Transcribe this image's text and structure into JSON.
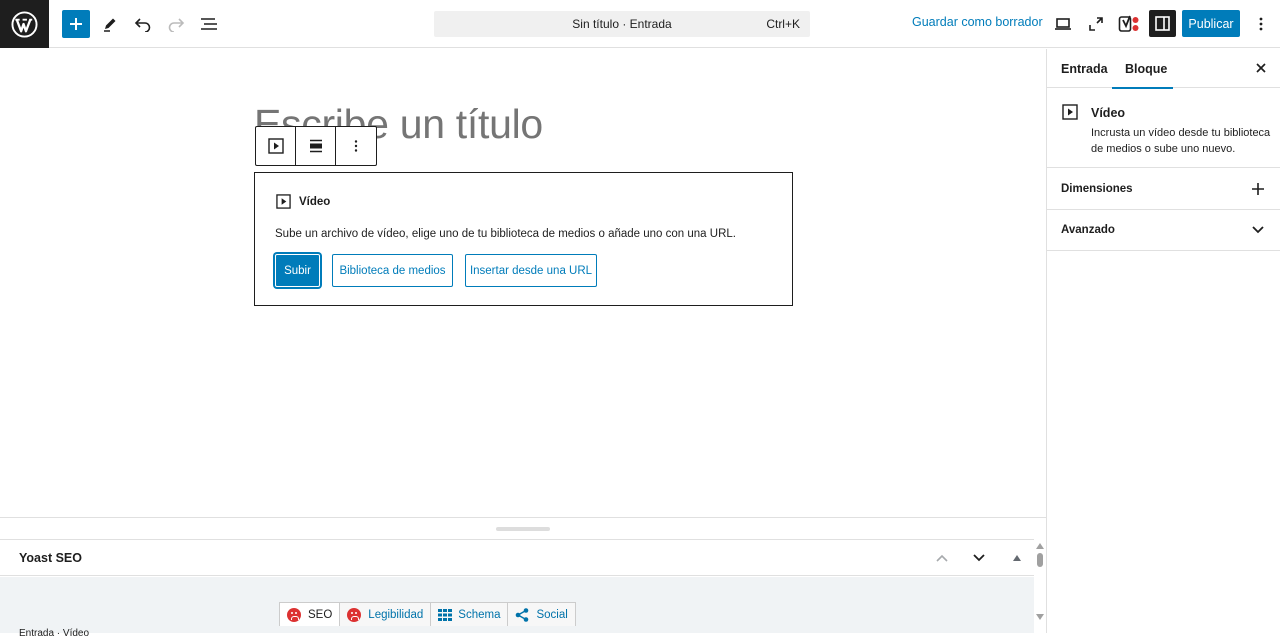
{
  "header": {
    "command_title": "Sin título · Entrada",
    "command_shortcut": "Ctrl+K",
    "save_draft": "Guardar como borrador",
    "publish": "Publicar"
  },
  "editor": {
    "title_placeholder": "Escribe un título",
    "video_block": {
      "label": "Vídeo",
      "description": "Sube un archivo de vídeo, elige uno de tu biblioteca de medios o añade uno con una URL.",
      "upload": "Subir",
      "media_library": "Biblioteca de medios",
      "insert_url": "Insertar desde una URL"
    }
  },
  "sidebar": {
    "tab_post": "Entrada",
    "tab_block": "Bloque",
    "block_title": "Vídeo",
    "block_description": "Incrusta un vídeo desde tu biblioteca de medios o sube uno nuevo.",
    "panels": [
      "Dimensiones",
      "Avanzado"
    ]
  },
  "metabox": {
    "title": "Yoast SEO",
    "tabs": [
      "SEO",
      "Legibilidad",
      "Schema",
      "Social"
    ]
  },
  "status_bar": "Entrada · Vídeo",
  "colors": {
    "accent": "#007cba",
    "dark": "#1e1e1e",
    "error": "#dc3232"
  }
}
